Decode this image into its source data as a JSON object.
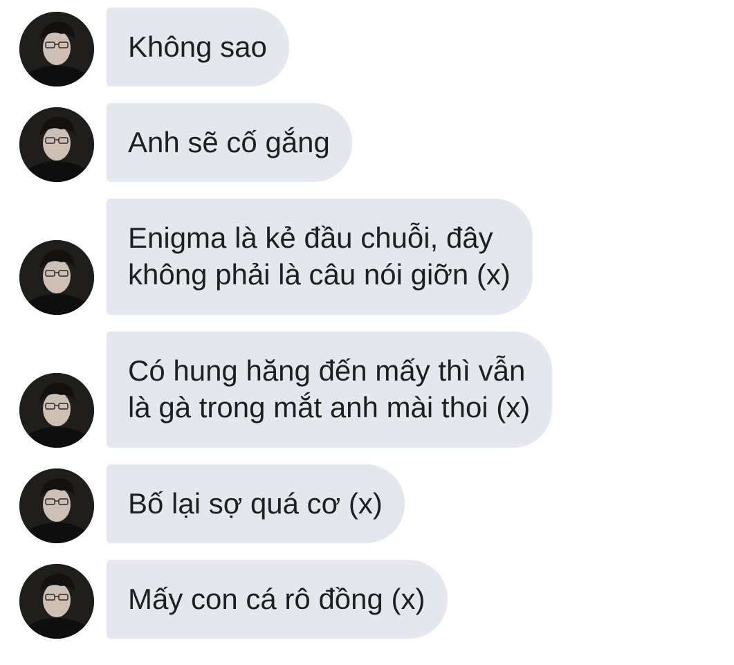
{
  "conversation": {
    "messages": [
      {
        "text": "Không sao",
        "avatar_icon": "user-avatar"
      },
      {
        "text": "Anh sẽ cố gắng",
        "avatar_icon": "user-avatar"
      },
      {
        "text": "Enigma là kẻ đầu chuỗi, đây\nkhông phải là câu nói giỡn (x)",
        "avatar_icon": "user-avatar"
      },
      {
        "text": "Có hung hăng đến mấy thì vẫn\nlà gà trong mắt anh mài thoi (x)",
        "avatar_icon": "user-avatar"
      },
      {
        "text": "Bố lại sợ quá cơ (x)",
        "avatar_icon": "user-avatar"
      },
      {
        "text": "Mấy con cá rô đồng (x)",
        "avatar_icon": "user-avatar"
      }
    ]
  },
  "colors": {
    "bubble_background": "#e4e8ee",
    "text": "#1f1f1f",
    "page_background": "#ffffff"
  }
}
